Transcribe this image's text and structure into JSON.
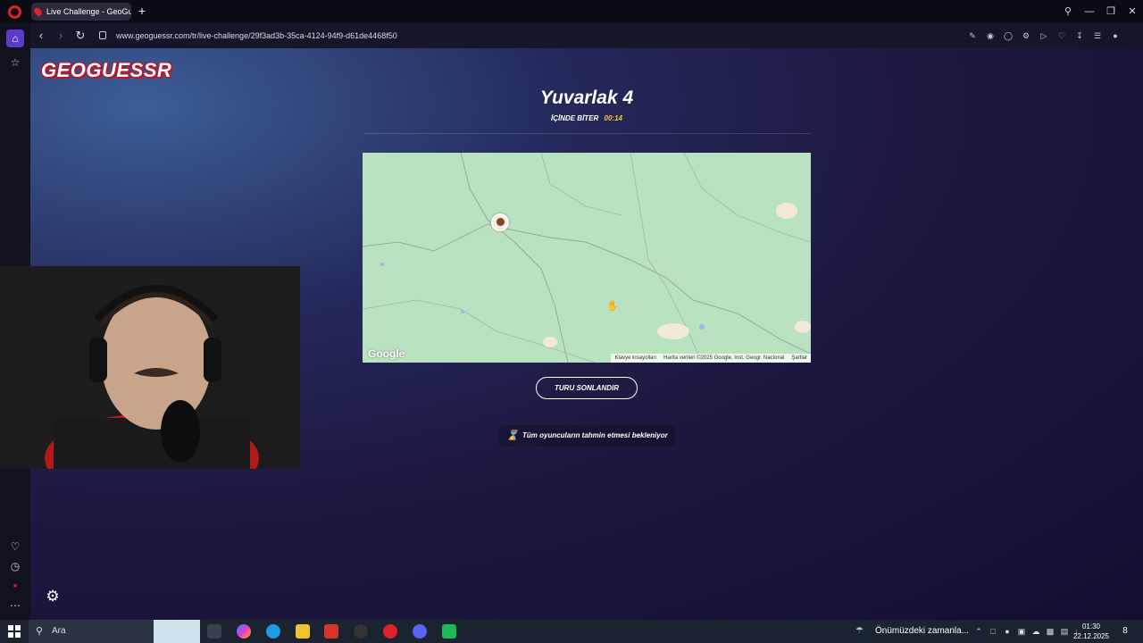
{
  "browser": {
    "tab_title": "Live Challenge - GeoGues",
    "new_tab_symbol": "+",
    "url": "www.geoguessr.com/tr/live-challenge/29f3ad3b-35ca-4124-94f9-d61de4468f50"
  },
  "page": {
    "logo_text": "GEOGUESSR",
    "round_title": "Yuvarlak 4",
    "timer_label": "İÇİNDE BİTER",
    "timer_value": "00:14",
    "end_round_button": "TURU SONLANDIR",
    "waiting_message": "Tüm oyuncuların tahmin etmesi bekleniyor"
  },
  "map": {
    "google_logo": "Google",
    "attribution": {
      "shortcuts": "Klavye kısayolları",
      "data": "Harita verileri ©2025 Google, Inst. Geogr. Nacional",
      "terms": "Şartlar"
    },
    "colors": {
      "land": "#b9e2c0",
      "road": "#9aa8a0"
    }
  },
  "taskbar": {
    "search_placeholder": "Ara",
    "weather_text": "Önümüzdeki zamanla...",
    "time": "01:30",
    "date": "22.12.2025",
    "notification_count": "8"
  },
  "colors": {
    "accent": "#5a3cc8",
    "brand_red": "#c01224",
    "timer_yellow": "#f5c842"
  }
}
